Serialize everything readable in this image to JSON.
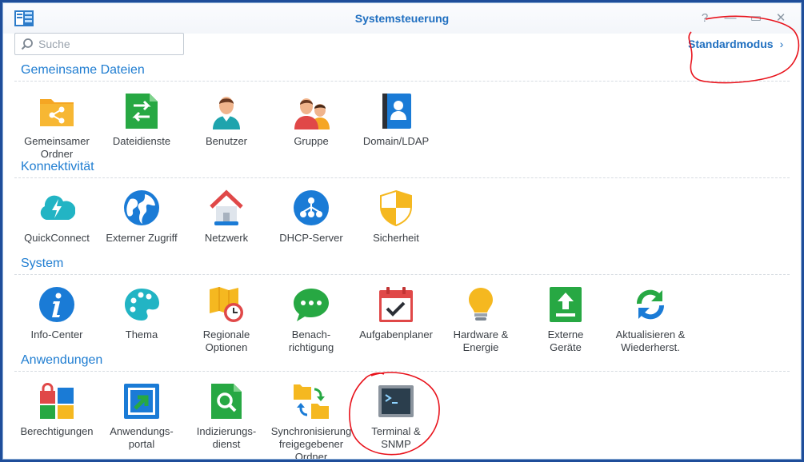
{
  "window": {
    "title": "Systemsteuerung"
  },
  "controls": {
    "help": "?",
    "minimize": "—",
    "maximize": "▭",
    "close": "✕"
  },
  "search": {
    "placeholder": "Suche"
  },
  "mode_link": "Standardmodus",
  "sections": [
    {
      "title": "Gemeinsame Dateien",
      "items": [
        {
          "label": "Gemeinsamer\nOrdner",
          "icon": "shared-folder-icon"
        },
        {
          "label": "Dateidienste",
          "icon": "file-services-icon"
        },
        {
          "label": "Benutzer",
          "icon": "user-icon"
        },
        {
          "label": "Gruppe",
          "icon": "group-icon"
        },
        {
          "label": "Domain/LDAP",
          "icon": "domain-ldap-icon"
        }
      ]
    },
    {
      "title": "Konnektivität",
      "items": [
        {
          "label": "QuickConnect",
          "icon": "quickconnect-icon"
        },
        {
          "label": "Externer Zugriff",
          "icon": "globe-icon"
        },
        {
          "label": "Netzwerk",
          "icon": "network-house-icon"
        },
        {
          "label": "DHCP-Server",
          "icon": "dhcp-icon"
        },
        {
          "label": "Sicherheit",
          "icon": "shield-icon"
        }
      ]
    },
    {
      "title": "System",
      "items": [
        {
          "label": "Info-Center",
          "icon": "info-icon"
        },
        {
          "label": "Thema",
          "icon": "palette-icon"
        },
        {
          "label": "Regionale\nOptionen",
          "icon": "map-clock-icon"
        },
        {
          "label": "Benach-\nrichtigung",
          "icon": "chat-bubble-icon"
        },
        {
          "label": "Aufgabenplaner",
          "icon": "calendar-check-icon"
        },
        {
          "label": "Hardware &\nEnergie",
          "icon": "lightbulb-icon"
        },
        {
          "label": "Externe\nGeräte",
          "icon": "external-device-icon"
        },
        {
          "label": "Aktualisieren &\nWiederherst.",
          "icon": "refresh-icon"
        }
      ]
    },
    {
      "title": "Anwendungen",
      "items": [
        {
          "label": "Berechtigungen",
          "icon": "privileges-icon"
        },
        {
          "label": "Anwendungs-\nportal",
          "icon": "app-portal-icon"
        },
        {
          "label": "Indizierungs-\ndienst",
          "icon": "indexing-icon"
        },
        {
          "label": "Synchronisierung\nfreigegebener\nOrdner",
          "icon": "folder-sync-icon"
        },
        {
          "label": "Terminal &\nSNMP",
          "icon": "terminal-icon"
        }
      ]
    }
  ],
  "colors": {
    "accent": "#1f7dd1",
    "annotation": "#e8121b"
  }
}
